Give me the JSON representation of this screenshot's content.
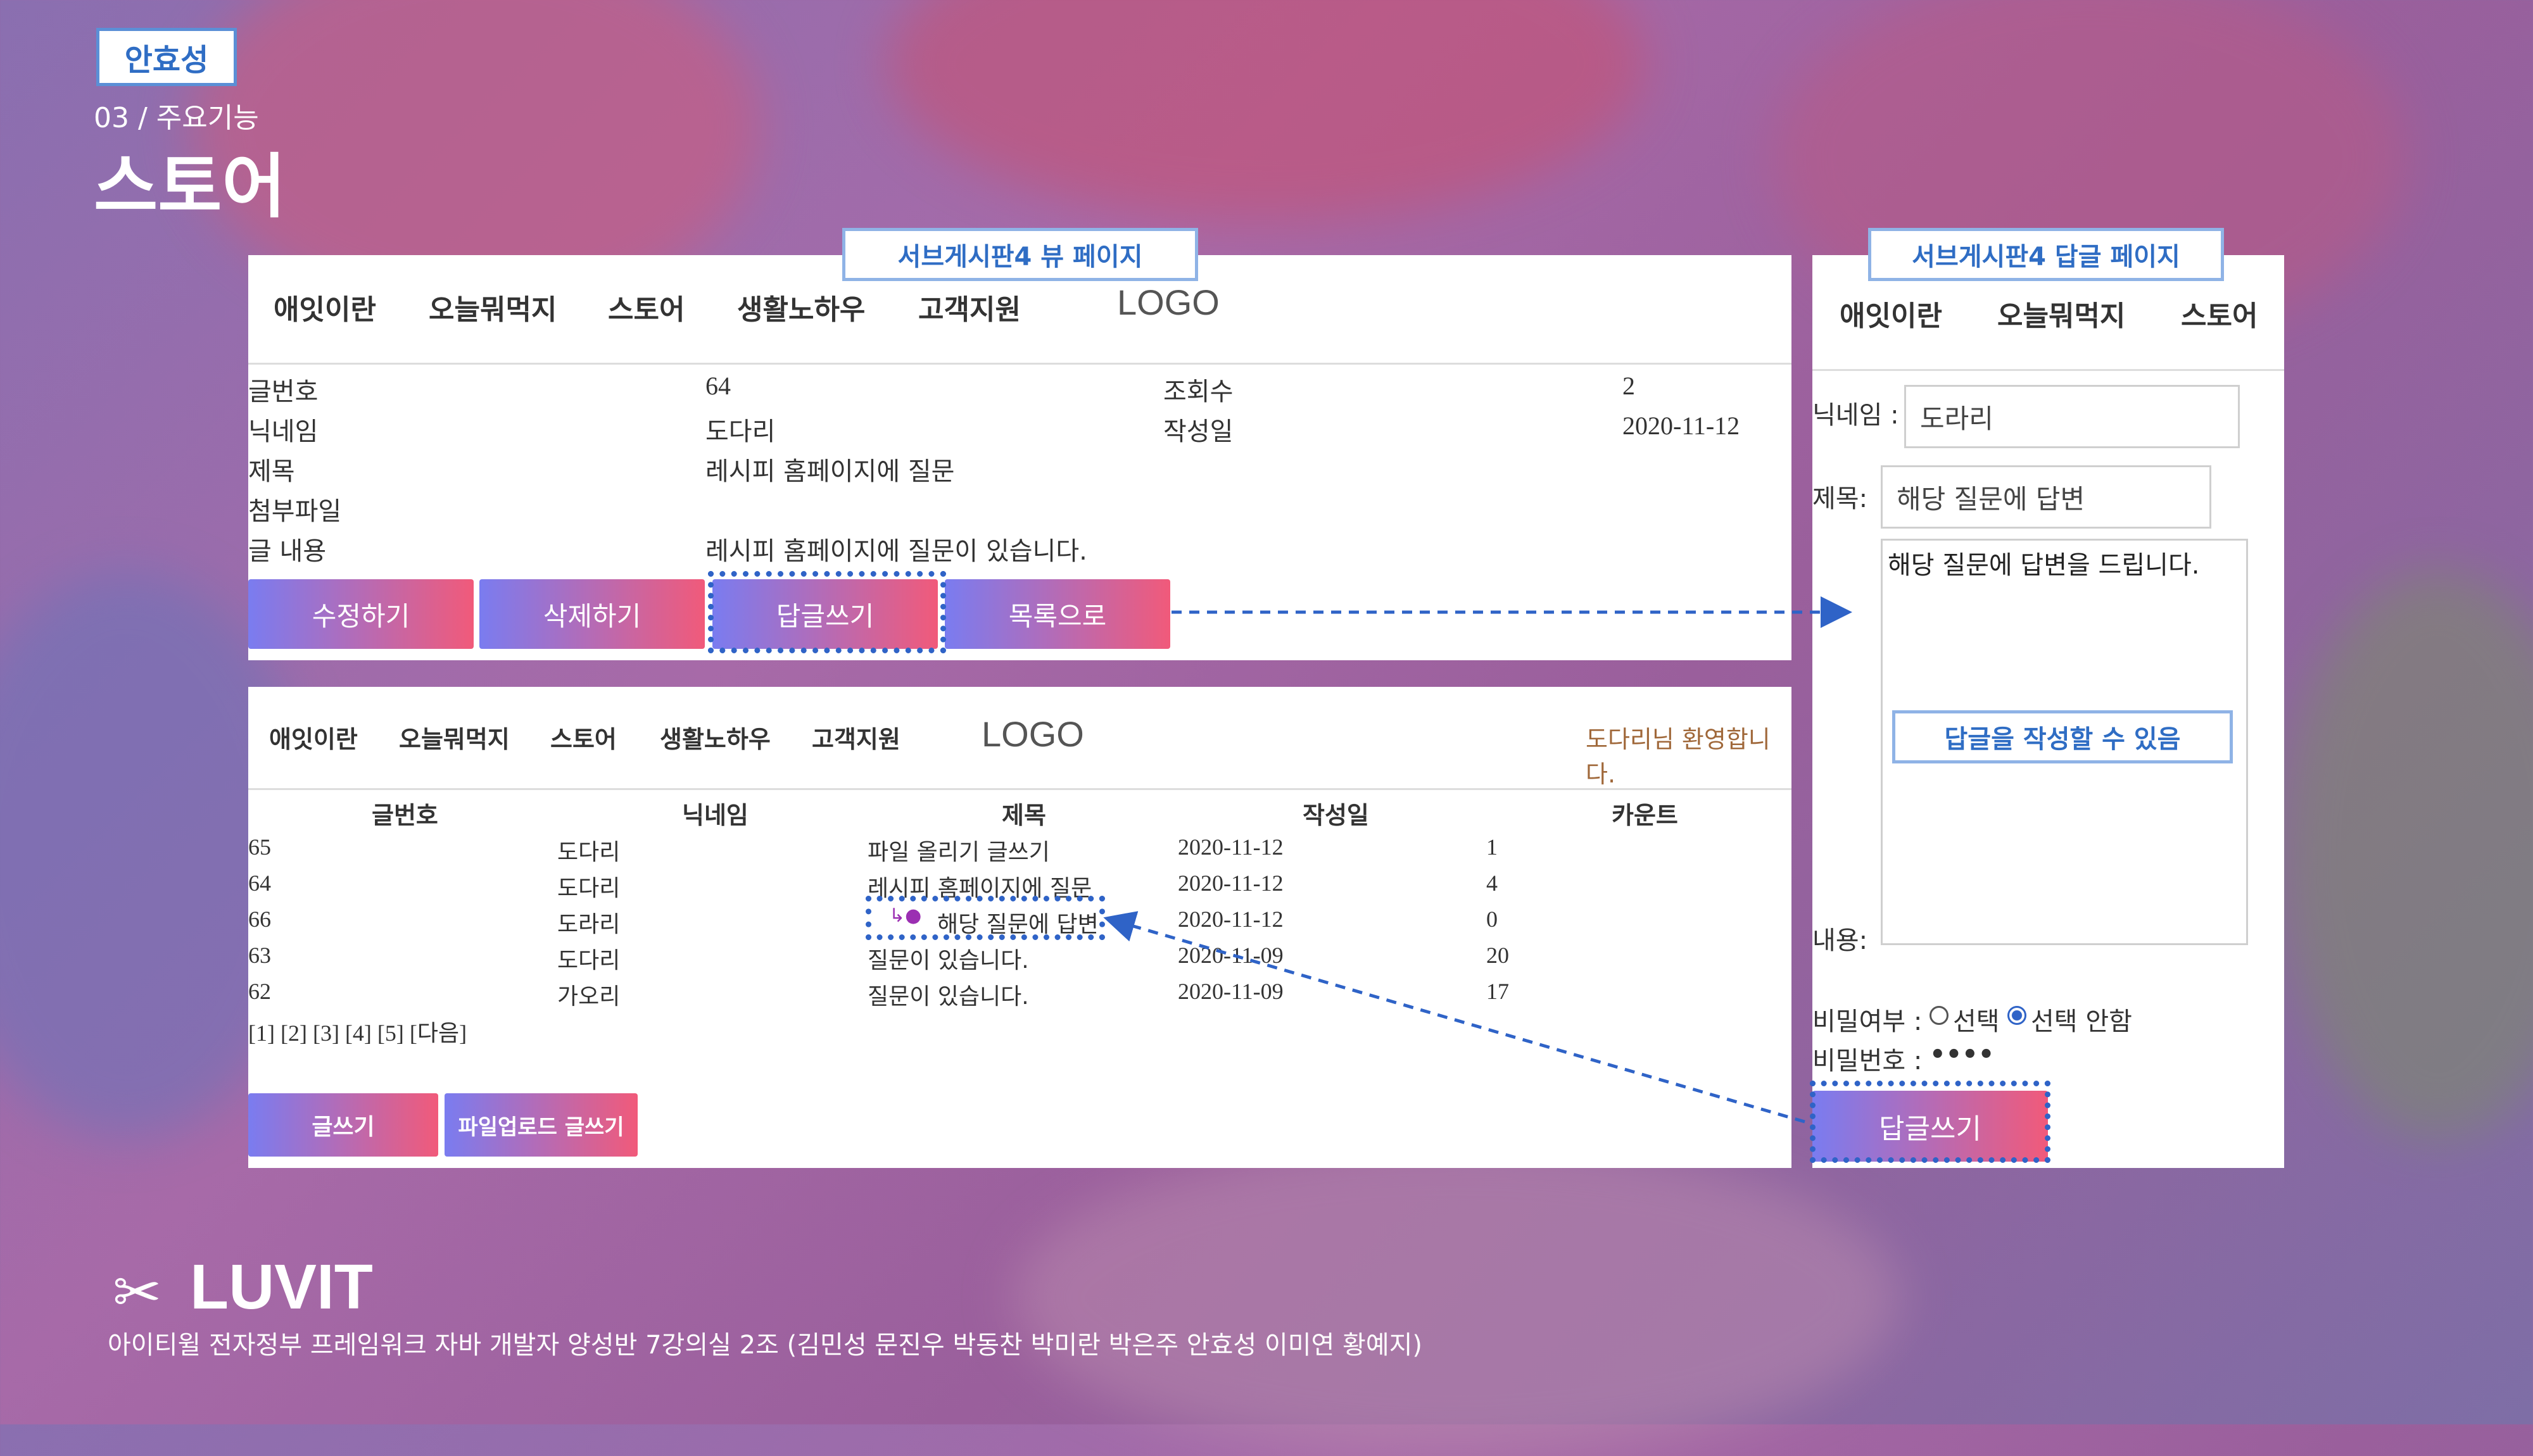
{
  "header": {
    "name_tag": "안효성",
    "subtitle": "03 / 주요기능",
    "title": "스토어"
  },
  "view_page": {
    "callout": "서브게시판4 뷰 페이지",
    "nav": [
      "애잇이란",
      "오늘뭐먹지",
      "스토어",
      "생활노하우",
      "고객지원"
    ],
    "logo": "LOGO",
    "fields": [
      {
        "label": "글번호",
        "value": "64",
        "label2": "조회수",
        "value2": "2"
      },
      {
        "label": "닉네임",
        "value": "도다리",
        "label2": "작성일",
        "value2": "2020-11-12"
      },
      {
        "label": "제목",
        "value": "레시피 홈페이지에 질문",
        "label2": "",
        "value2": ""
      },
      {
        "label": "첨부파일",
        "value": "",
        "label2": "",
        "value2": ""
      },
      {
        "label": "글 내용",
        "value": "레시피 홈페이지에 질문이 있습니다.",
        "label2": "",
        "value2": ""
      }
    ],
    "buttons": [
      "수정하기",
      "삭제하기",
      "답글쓰기",
      "목록으로"
    ]
  },
  "list_page": {
    "nav": [
      "애잇이란",
      "오늘뭐먹지",
      "스토어",
      "생활노하우",
      "고객지원"
    ],
    "logo": "LOGO",
    "welcome": "도다리님 환영합니다.",
    "columns": [
      "글번호",
      "닉네임",
      "제목",
      "작성일",
      "카운트"
    ],
    "rows": [
      [
        "65",
        "도다리",
        "파일 올리기 글쓰기",
        "2020-11-12",
        "1"
      ],
      [
        "64",
        "도다리",
        "레시피 홈페이지에 질문",
        "2020-11-12",
        "4"
      ],
      [
        "66",
        "도라리",
        "해당 질문에 답변",
        "2020-11-12",
        "0"
      ],
      [
        "63",
        "도다리",
        "질문이 있습니다.",
        "2020-11-09",
        "20"
      ],
      [
        "62",
        "가오리",
        "질문이 있습니다.",
        "2020-11-09",
        "17"
      ]
    ],
    "pagination": "[1] [2] [3] [4] [5] [다음]",
    "buttons": [
      "글쓰기",
      "파일업로드 글쓰기"
    ]
  },
  "reply_page": {
    "callout": "서브게시판4 답글 페이지",
    "nav": [
      "애잇이란",
      "오늘뭐먹지",
      "스토어"
    ],
    "nickname_label": "닉네임 :",
    "nickname_value": "도라리",
    "title_label": "제목:",
    "title_value": "해당 질문에 답변",
    "content_value": "해당 질문에 답변을 드립니다.",
    "content_label": "내용:",
    "note": "답글을 작성할 수 있음",
    "secret_label": "비밀여부 :",
    "secret_opt1": "선택",
    "secret_opt2": "선택 안함",
    "password_label": "비밀번호 :",
    "password_value": "••••",
    "submit": "답글쓰기"
  },
  "footer": {
    "brand": "LUVIT",
    "credits": "아이티윌 전자정부 프레임워크 자바 개발자 양성반 7강의실 2조 (김민성 문진우 박동찬 박미란 박은주 안효성 이미연 황예지)"
  },
  "colors": {
    "accent_blue": "#2f63c7",
    "btn_from": "#7a7cf0",
    "btn_to": "#f15a7a"
  }
}
